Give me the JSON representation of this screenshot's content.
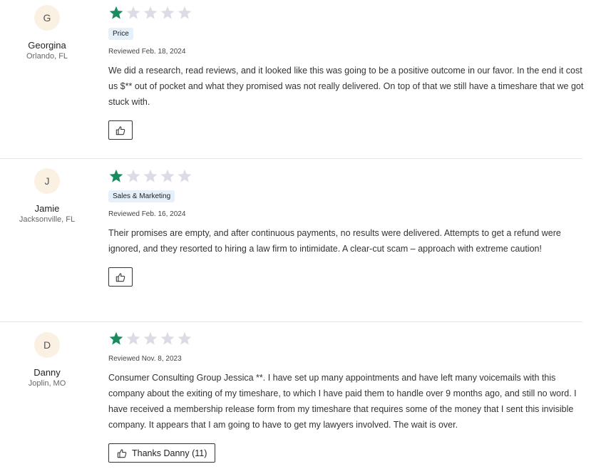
{
  "reviews": [
    {
      "initial": "G",
      "name": "Georgina",
      "location": "Orlando, FL",
      "rating": 1,
      "max_rating": 5,
      "tag": "Price",
      "reviewed": "Reviewed Feb. 18, 2024",
      "text": "We did a research, read reviews, and it looked like this was going to be a positive outcome in our favor. In the end it cost us $** out of pocket and what they promised was not really delivered. On top of that we still have a timeshare that we got stuck with.",
      "helpful_label": ""
    },
    {
      "initial": "J",
      "name": "Jamie",
      "location": "Jacksonville, FL",
      "rating": 1,
      "max_rating": 5,
      "tag": "Sales & Marketing",
      "reviewed": "Reviewed Feb. 16, 2024",
      "text": "Their promises are empty, and after continuous payments, no results were delivered. Attempts to get a refund were ignored, and they resorted to hiring a law firm to intimidate. A clear-cut scam – approach with extreme caution!",
      "helpful_label": ""
    },
    {
      "initial": "D",
      "name": "Danny",
      "location": "Joplin, MO",
      "rating": 1,
      "max_rating": 5,
      "tag": "",
      "reviewed": "Reviewed Nov. 8, 2023",
      "text": "Consumer Consulting Group Jessica **. I have set up many appointments and have left many voicemails with this company about the exiting of my timeshare, to which I have paid them to handle over 9 months ago, and still no word. I have received a membership release form from my timeshare that requires some of the money that I sent this invisible company. It appears that I am going to have to get my lawyers involved. The wait is over.",
      "helpful_label": "Thanks Danny (11)"
    }
  ],
  "icons": {
    "star": "star-icon",
    "thumbs_up": "thumbs-up-icon"
  },
  "colors": {
    "star_filled": "#1a8a5f",
    "star_empty": "#dcdce6",
    "avatar_bg": "#fbf1e3",
    "tag_bg": "#e6f0fb"
  }
}
